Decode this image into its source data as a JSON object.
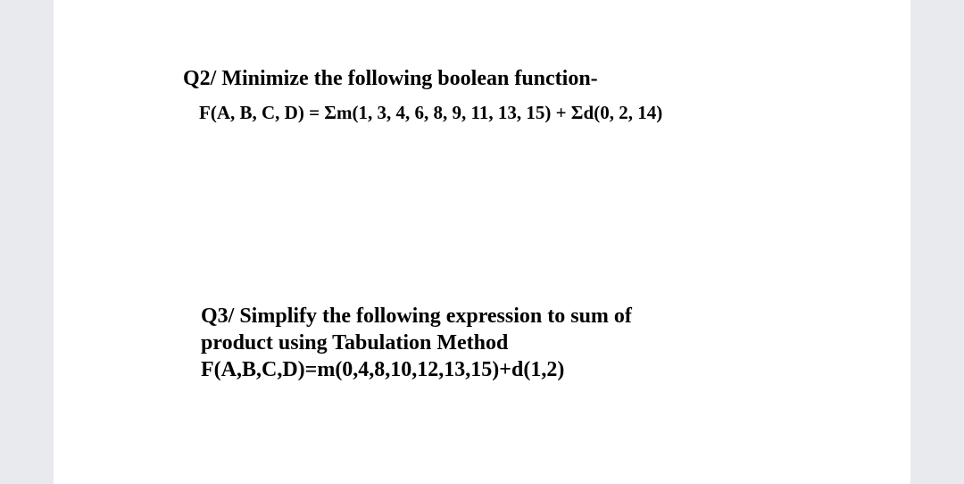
{
  "q2": {
    "title": "Q2/ Minimize the following boolean function-",
    "formula": "F(A, B, C, D) = Σm(1, 3, 4, 6, 8, 9, 11, 13, 15) + Σd(0, 2, 14)"
  },
  "q3": {
    "line1": "Q3/ Simplify the following expression to sum of",
    "line2": "product using Tabulation Method",
    "formula": "F(A,B,C,D)=m(0,4,8,10,12,13,15)+d(1,2)"
  }
}
